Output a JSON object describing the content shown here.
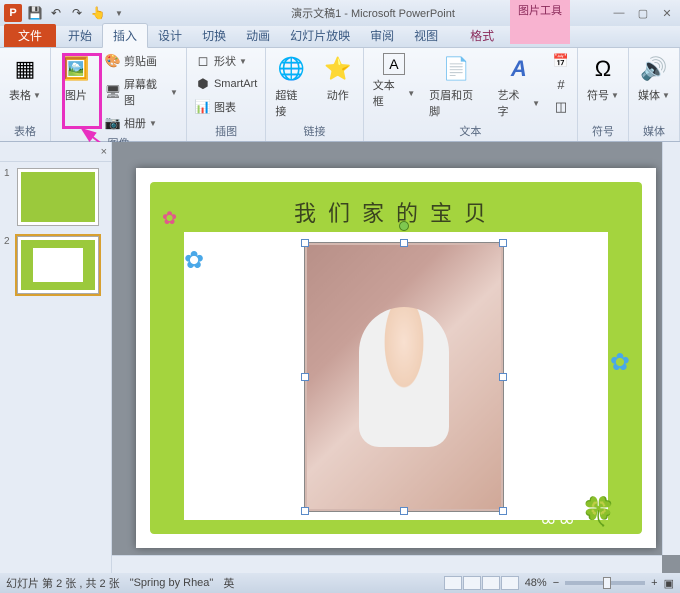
{
  "app_icon": "P",
  "title": "演示文稿1 - Microsoft PowerPoint",
  "context_tool": {
    "label": "图片工具",
    "tab": "格式"
  },
  "win": {
    "min": "—",
    "max": "▢",
    "close": "✕",
    "help": "?"
  },
  "tabs": {
    "file": "文件",
    "items": [
      "开始",
      "插入",
      "设计",
      "切换",
      "动画",
      "幻灯片放映",
      "审阅",
      "视图"
    ],
    "active_index": 1
  },
  "ribbon": {
    "groups": {
      "tables": {
        "label": "表格",
        "table_btn": "表格"
      },
      "images": {
        "label": "图像",
        "picture": "图片",
        "clipart": "剪贴画",
        "screenshot": "屏幕截图",
        "album": "相册"
      },
      "illus": {
        "label": "插图",
        "shapes": "形状",
        "smartart": "SmartArt",
        "chart": "图表"
      },
      "links": {
        "label": "链接",
        "hyperlink": "超链接",
        "action": "动作"
      },
      "text": {
        "label": "文本",
        "textbox": "文本框",
        "headerfooter": "页眉和页脚",
        "wordart": "艺术字"
      },
      "symbols": {
        "label": "符号",
        "symbol": "符号"
      },
      "media": {
        "label": "媒体",
        "media": "媒体"
      }
    }
  },
  "slide_panel": {
    "close": "×",
    "slides": [
      {
        "num": "1"
      },
      {
        "num": "2"
      }
    ],
    "selected": 1,
    "icon": "✎"
  },
  "slide": {
    "title": "我们家的宝贝"
  },
  "status": {
    "slide_info": "幻灯片 第 2 张 , 共 2 张",
    "theme": "\"Spring by Rhea\"",
    "lang": "英",
    "zoom": "48%",
    "fit": "▣"
  }
}
